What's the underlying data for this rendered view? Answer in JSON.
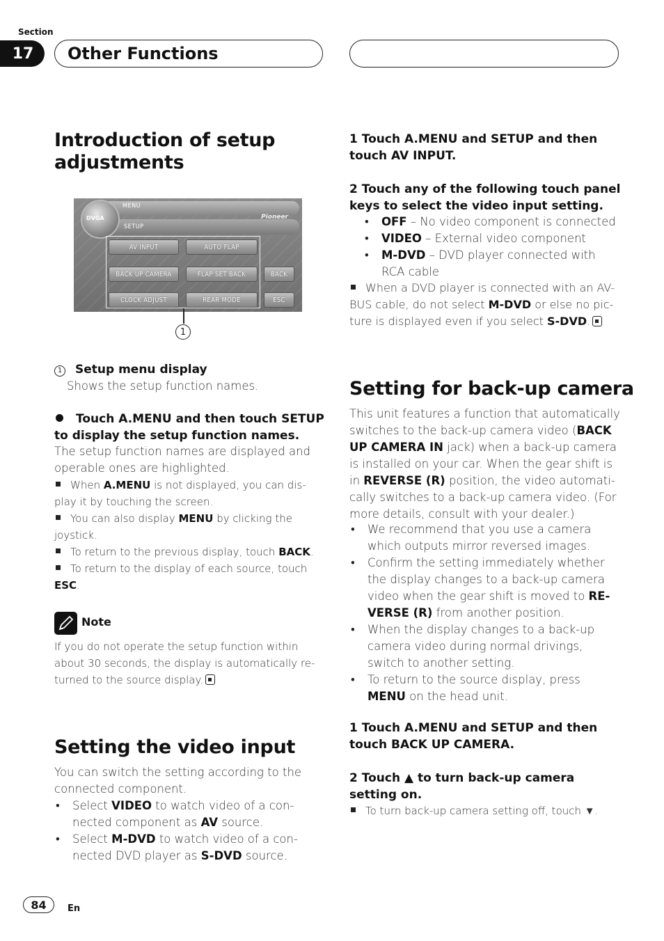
{
  "header": {
    "section_label": "Section",
    "section_number": "17",
    "section_title": "Other Functions"
  },
  "intro": {
    "heading_line1": "Introduction of setup",
    "heading_line2": "adjustments",
    "screen": {
      "menu_label": "MENU",
      "setup_label": "SETUP",
      "logo_text": "DVGA",
      "brand": "Pioneer",
      "buttons": [
        "AV INPUT",
        "AUTO FLAP",
        "BACK UP CAMERA",
        "FLAP SET BACK",
        "CLOCK ADJUST",
        "REAR MODE"
      ],
      "back_button": "BACK",
      "esc_button": "ESC"
    },
    "callout_number": "1",
    "callout_title": "Setup menu display",
    "callout_desc": "Shows the setup function names.",
    "step_title_line1": "Touch A.MENU and then touch SETUP",
    "step_title_line2": "to display the setup function names.",
    "step_body": "The setup function names are displayed and operable ones are highlighted.",
    "tips": [
      {
        "pre": "When ",
        "bold": "A.MENU",
        "post": " is not displayed, you can dis-play it by touching the screen."
      },
      {
        "pre": "You can also display ",
        "bold": "MENU",
        "post": " by clicking the joystick."
      },
      {
        "pre": "To return to the previous display, touch ",
        "bold": "BACK",
        "post": "."
      },
      {
        "pre": "To return to the display of each source, touch ",
        "bold": "ESC",
        "post": "."
      }
    ],
    "note_label": "Note",
    "note_text": "If you do not operate the setup function within about 30 seconds, the display is automatically re-turned to the source display."
  },
  "video_input": {
    "heading": "Setting the video input",
    "intro": "You can switch the setting according to the connected component.",
    "bullets": [
      {
        "a": "Select ",
        "b1": "VIDEO",
        "c": " to watch video of a con-nected component as ",
        "b2": "AV",
        "d": " source."
      },
      {
        "a": "Select ",
        "b1": "M-DVD",
        "c": " to watch video of a con-nected DVD player as ",
        "b2": "S-DVD",
        "d": " source."
      }
    ],
    "step1": "1    Touch A.MENU and SETUP and then touch AV INPUT.",
    "step2": "2    Touch any of the following touch panel keys to select the video input setting.",
    "options": [
      {
        "key": "OFF",
        "desc": " – No video component is connected"
      },
      {
        "key": "VIDEO",
        "desc": " – External video component"
      },
      {
        "key": "M-DVD",
        "desc": " – DVD player connected with RCA cable"
      }
    ],
    "warning": {
      "a": "When a DVD player is connected with an AV-BUS cable, do not select ",
      "b1": "M-DVD",
      "c": " or else no pic-ture is displayed even if you select ",
      "b2": "S-DVD",
      "d": "."
    }
  },
  "backup_camera": {
    "heading": "Setting for back-up camera",
    "intro": {
      "a": "This unit features a function that automatically switches to the back-up camera video (",
      "b1": "BACK UP CAMERA IN",
      "c": " jack) when a back-up camera is installed on your car. When the gear shift is in ",
      "b2": "REVERSE (R)",
      "d": " position, the video automati-cally switches to a back-up camera video. (For more details, consult with your dealer.)"
    },
    "bullets": [
      {
        "a": "We recommend that you use a camera which outputs mirror reversed images.",
        "b": "",
        "c": ""
      },
      {
        "a": "Confirm the setting immediately whether the display changes to a back-up camera video when the gear shift is moved to ",
        "b": "RE-VERSE (R)",
        "c": " from another position."
      },
      {
        "a": "When the display changes to a back-up camera video during normal drivings, switch to another setting.",
        "b": "",
        "c": ""
      },
      {
        "a": "To return to the source display, press ",
        "b": "MENU",
        "c": " on the head unit."
      }
    ],
    "step1": "1    Touch A.MENU and SETUP and then touch BACK UP CAMERA.",
    "step2": "2    Touch ▲ to turn back-up camera setting on.",
    "tip": "To turn back-up camera setting off, touch ▼."
  },
  "footer": {
    "page_number": "84",
    "language": "En"
  }
}
